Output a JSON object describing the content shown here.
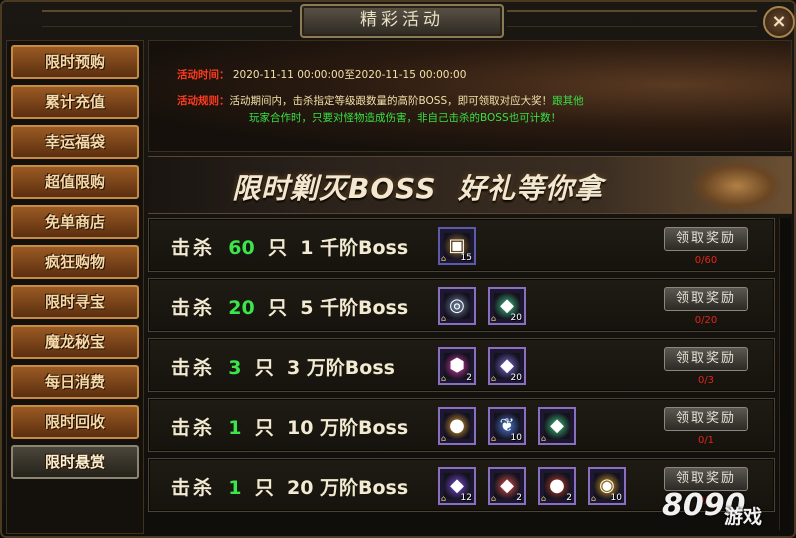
{
  "window": {
    "title": "精彩活动",
    "close_label": "×"
  },
  "sidebar": {
    "items": [
      {
        "label": "限时预购"
      },
      {
        "label": "累计充值"
      },
      {
        "label": "幸运福袋"
      },
      {
        "label": "超值限购"
      },
      {
        "label": "免单商店"
      },
      {
        "label": "疯狂购物"
      },
      {
        "label": "限时寻宝"
      },
      {
        "label": "魔龙秘宝"
      },
      {
        "label": "每日消费"
      },
      {
        "label": "限时回收"
      },
      {
        "label": "限时悬赏",
        "active": true
      }
    ]
  },
  "info": {
    "time_label": "活动时间：",
    "time_value": "2020-11-11 00:00:00至2020-11-15 00:00:00",
    "rule_label": "活动规则：",
    "rule_text_1": "活动期间内，击杀指定等级跟数量的高阶BOSS，即可领取对应大奖！",
    "rule_text_green_1": "跟其他",
    "rule_text_green_2": "玩家合作时，只要对怪物造成伤害，非自己击杀的BOSS也可计数！"
  },
  "banner": {
    "text": "限时剿灭BOSS  好礼等你拿"
  },
  "rows": [
    {
      "kill": "击杀",
      "count": "60",
      "unit": "只",
      "tier": "1 千阶Boss",
      "claim": "领取奖励",
      "progress": "0/60",
      "items": [
        {
          "icon": "treasure-chest-icon",
          "count": "15",
          "color": "#a07a2a"
        }
      ]
    },
    {
      "kill": "击杀",
      "count": "20",
      "unit": "只",
      "tier": "5 千阶Boss",
      "claim": "领取奖励",
      "progress": "0/20",
      "items": [
        {
          "icon": "compass-disc-icon",
          "count": "",
          "color": "#6b7f9a"
        },
        {
          "icon": "green-crystal-icon",
          "count": "20",
          "color": "#3fbf7f"
        }
      ]
    },
    {
      "kill": "击杀",
      "count": "3",
      "unit": "只",
      "tier": "3 万阶Boss",
      "claim": "领取奖励",
      "progress": "0/3",
      "items": [
        {
          "icon": "pink-gem-icon",
          "count": "2",
          "color": "#d63aa8"
        },
        {
          "icon": "purple-crystal-icon",
          "count": "20",
          "color": "#7a6ad0"
        }
      ]
    },
    {
      "kill": "击杀",
      "count": "1",
      "unit": "只",
      "tier": "10 万阶Boss",
      "claim": "领取奖励",
      "progress": "0/1",
      "items": [
        {
          "icon": "rainbow-orb-icon",
          "count": "",
          "color": "#e0a030"
        },
        {
          "icon": "blue-feather-icon",
          "count": "10",
          "color": "#4a7ad8"
        },
        {
          "icon": "emerald-crystal-icon",
          "count": "",
          "color": "#3ac07a"
        }
      ]
    },
    {
      "kill": "击杀",
      "count": "1",
      "unit": "只",
      "tier": "20 万阶Boss",
      "claim": "领取奖励",
      "progress": "0/1",
      "items": [
        {
          "icon": "violet-crystal-icon",
          "count": "12",
          "color": "#7a4ad8"
        },
        {
          "icon": "red-crystal-icon",
          "count": "2",
          "color": "#d0504a"
        },
        {
          "icon": "red-orb-icon",
          "count": "2",
          "color": "#c0402a"
        },
        {
          "icon": "gold-coin-icon",
          "count": "10",
          "color": "#d8a020"
        }
      ]
    }
  ],
  "watermark": {
    "brand_num": "8090",
    "brand_text": "游戏"
  }
}
